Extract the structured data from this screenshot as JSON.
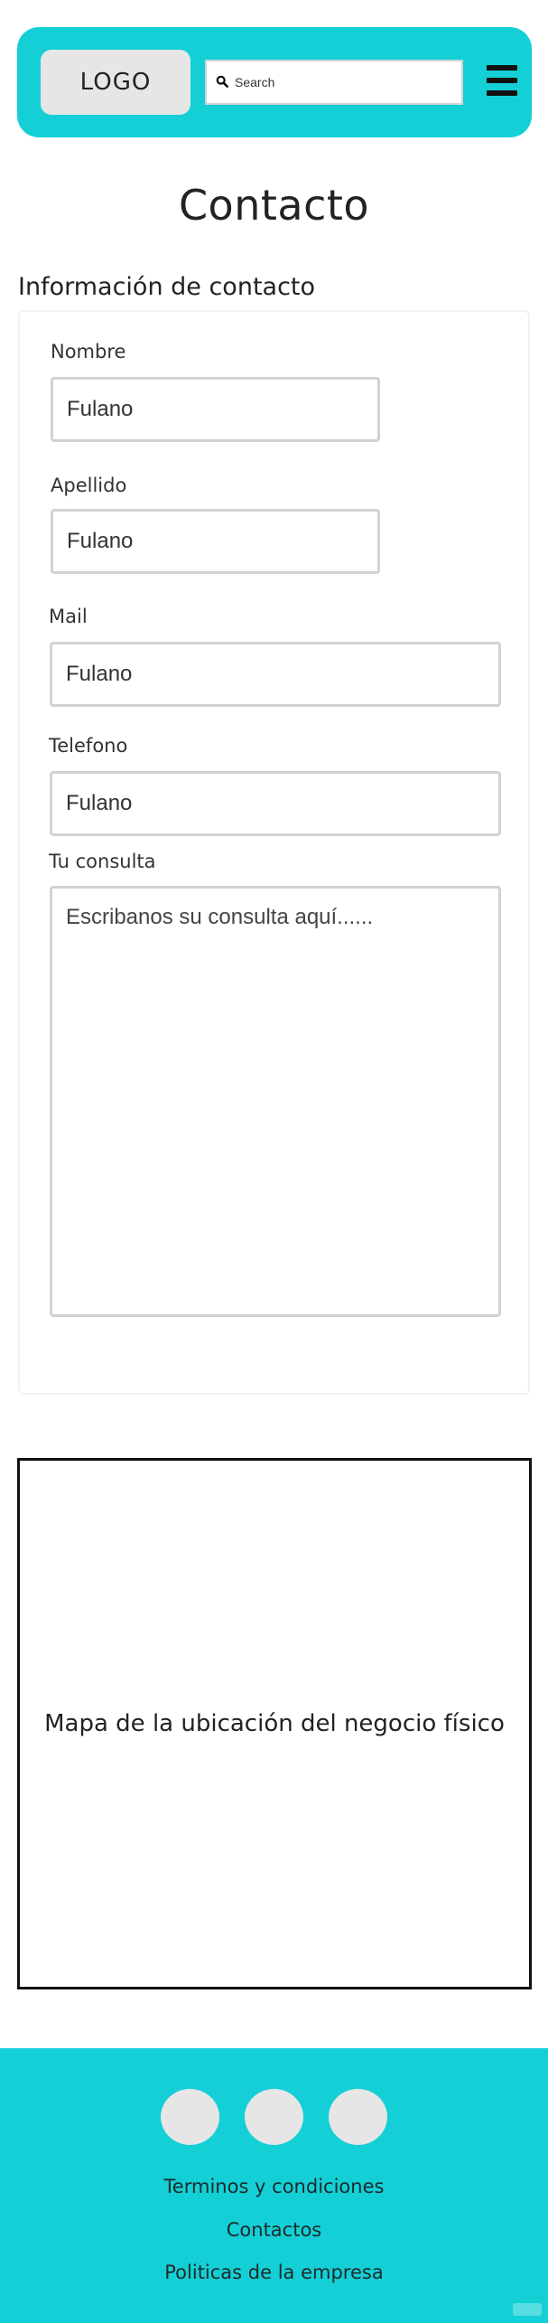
{
  "header": {
    "logo_label": "LOGO",
    "search": {
      "placeholder": "Search",
      "icon": "magnifier-icon"
    },
    "menu_icon": "hamburger-icon",
    "background_color": "#14cfd6"
  },
  "page": {
    "title": "Contacto",
    "section_title": "Información de contacto"
  },
  "form": {
    "fields": [
      {
        "label": "Nombre",
        "value": "Fulano"
      },
      {
        "label": "Apellido",
        "value": "Fulano"
      },
      {
        "label": "Mail",
        "value": "Fulano"
      },
      {
        "label": "Telefono",
        "value": "Fulano"
      }
    ],
    "message": {
      "label": "Tu consulta",
      "placeholder": "Escribanos su consulta aquí......"
    }
  },
  "map": {
    "text": "Mapa de la ubicación del negocio físico"
  },
  "footer": {
    "social_icons": [
      "social-icon",
      "social-icon",
      "social-icon"
    ],
    "links": [
      "Terminos y condiciones",
      "Contactos",
      "Politicas de la empresa"
    ],
    "background_color": "#14cfd6"
  }
}
